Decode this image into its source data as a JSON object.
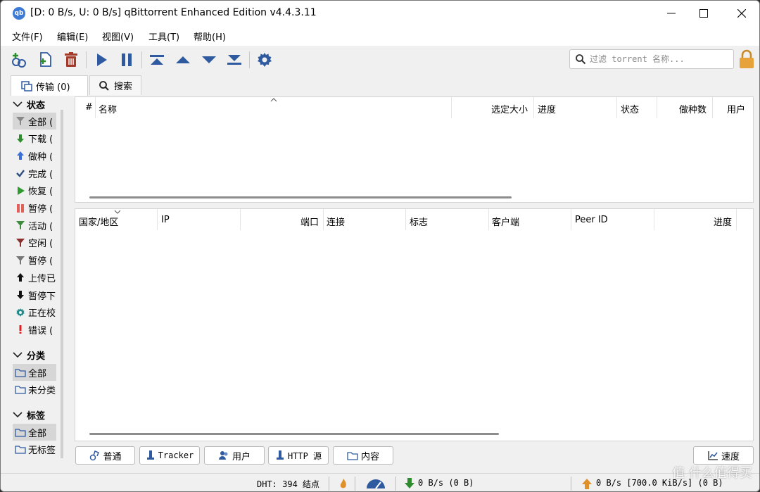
{
  "window": {
    "title": "[D: 0 B/s, U: 0 B/s] qBittorrent Enhanced Edition v4.4.3.11",
    "app_icon_text": "qb"
  },
  "menu": [
    "文件(F)",
    "编辑(E)",
    "视图(V)",
    "工具(T)",
    "帮助(H)"
  ],
  "search": {
    "placeholder": "过滤 torrent 名称..."
  },
  "tabs": {
    "transfers": "传输 (0)",
    "search": "搜索"
  },
  "sidebar": {
    "status_header": "状态",
    "status_items": [
      {
        "label": "全部 (",
        "icon": "filter-icon",
        "color": "#888888"
      },
      {
        "label": "下载 (",
        "icon": "arrow-down-icon",
        "color": "#2e8b2e"
      },
      {
        "label": "做种 (",
        "icon": "arrow-up-icon",
        "color": "#3a6fd8"
      },
      {
        "label": "完成 (",
        "icon": "check-icon",
        "color": "#2f4f7f"
      },
      {
        "label": "恢复 (",
        "icon": "play-icon",
        "color": "#2e9b2e"
      },
      {
        "label": "暂停 (",
        "icon": "pause-icon",
        "color": "#e0605a"
      },
      {
        "label": "活动 (",
        "icon": "filter-icon",
        "color": "#3c8c3c"
      },
      {
        "label": "空闲 (",
        "icon": "filter-icon",
        "color": "#8b2e2e"
      },
      {
        "label": "暂停 (",
        "icon": "filter-icon",
        "color": "#777777"
      },
      {
        "label": "上传已",
        "icon": "arrow-up-icon",
        "color": "#111111"
      },
      {
        "label": "暂停下",
        "icon": "arrow-down-icon",
        "color": "#111111"
      },
      {
        "label": "正在校",
        "icon": "gear-icon",
        "color": "#1f8a8a"
      },
      {
        "label": "错误 (",
        "icon": "exclamation-icon",
        "color": "#e02020"
      }
    ],
    "category_header": "分类",
    "category_items": [
      "全部",
      "未分类"
    ],
    "tag_header": "标签",
    "tag_items": [
      "全部",
      "无标签"
    ]
  },
  "torrent_columns": [
    "#",
    "名称",
    "选定大小",
    "进度",
    "状态",
    "做种数",
    "用户"
  ],
  "peer_columns": [
    "国家/地区",
    "IP",
    "端口",
    "连接",
    "标志",
    "客户端",
    "Peer ID",
    "进度"
  ],
  "bottom_tabs": {
    "general": "普通",
    "trackers": "Tracker",
    "peers": "用户",
    "http": "HTTP 源",
    "content": "内容",
    "speed": "速度"
  },
  "status": {
    "dht": "DHT: 394 结点",
    "download": "0 B/s (0 B)",
    "upload": "0 B/s [700.0 KiB/s] (0 B)"
  },
  "watermark": "值 什么值得买",
  "colors": {
    "play": "#2f5aa0",
    "trash": "#a33a2a",
    "lock": "#e8a23a",
    "status_down": "#2e8b2e",
    "status_up": "#e0902a"
  }
}
